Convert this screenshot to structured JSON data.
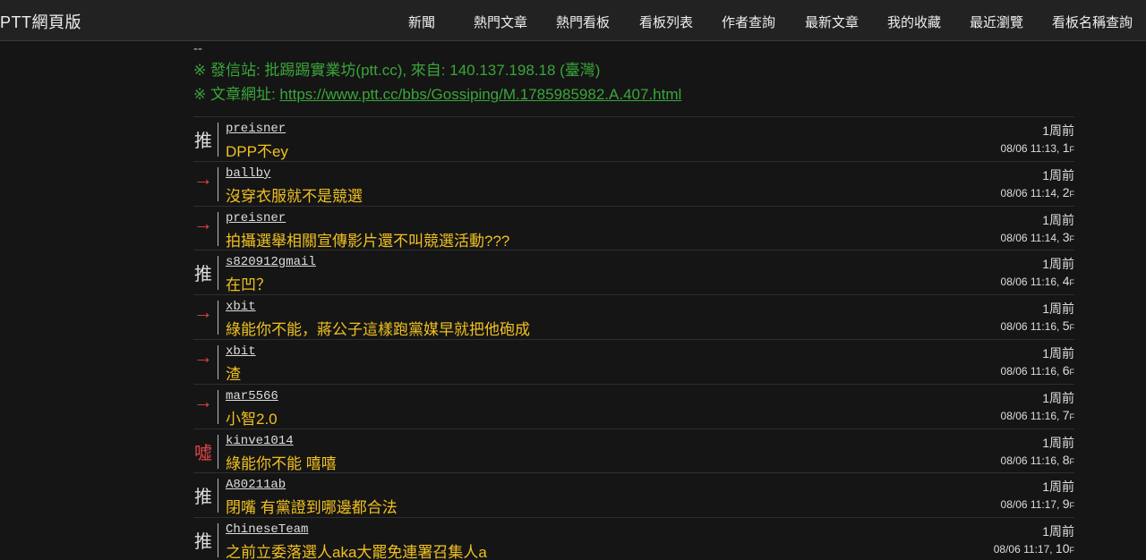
{
  "header": {
    "logo": "PTT網頁版",
    "nav": [
      {
        "label": "新聞"
      },
      {
        "label": "熱門文章"
      },
      {
        "label": "熱門看板"
      },
      {
        "label": "看板列表"
      },
      {
        "label": "作者查詢"
      },
      {
        "label": "最新文章"
      },
      {
        "label": "我的收藏"
      },
      {
        "label": "最近瀏覽"
      },
      {
        "label": "看板名稱查詢"
      }
    ]
  },
  "article": {
    "separator": "--",
    "source_line": "※ 發信站: 批踢踢實業坊(ptt.cc), 來自: 140.137.198.18 (臺灣)",
    "url_prefix": "※ 文章網址: ",
    "url": "https://www.ptt.cc/bbs/Gossiping/M.1785985982.A.407.html"
  },
  "pushes": [
    {
      "tag": "推",
      "type": "push",
      "user": "preisner",
      "msg": "DPP不ey",
      "ago": "1周前",
      "time": "08/06 11:13, ",
      "floor": "1",
      "floor_unit": "F"
    },
    {
      "tag": "→",
      "type": "arrow",
      "user": "ballby",
      "msg": "沒穿衣服就不是競選",
      "ago": "1周前",
      "time": "08/06 11:14, ",
      "floor": "2",
      "floor_unit": "F"
    },
    {
      "tag": "→",
      "type": "arrow",
      "user": "preisner",
      "msg": "拍攝選舉相關宣傳影片還不叫競選活動???",
      "ago": "1周前",
      "time": "08/06 11:14, ",
      "floor": "3",
      "floor_unit": "F"
    },
    {
      "tag": "推",
      "type": "push",
      "user": "s820912gmail",
      "msg": "在凹？",
      "ago": "1周前",
      "time": "08/06 11:16, ",
      "floor": "4",
      "floor_unit": "F"
    },
    {
      "tag": "→",
      "type": "arrow",
      "user": "xbit",
      "msg": "綠能你不能，蔣公子這樣跑黨媒早就把他砲成",
      "ago": "1周前",
      "time": "08/06 11:16, ",
      "floor": "5",
      "floor_unit": "F"
    },
    {
      "tag": "→",
      "type": "arrow",
      "user": "xbit",
      "msg": "渣",
      "ago": "1周前",
      "time": "08/06 11:16, ",
      "floor": "6",
      "floor_unit": "F"
    },
    {
      "tag": "→",
      "type": "arrow",
      "user": "mar5566",
      "msg": "小智2.0",
      "ago": "1周前",
      "time": "08/06 11:16, ",
      "floor": "7",
      "floor_unit": "F"
    },
    {
      "tag": "噓",
      "type": "boo",
      "user": "kinve1014",
      "msg": "綠能你不能 嘻嘻",
      "ago": "1周前",
      "time": "08/06 11:16, ",
      "floor": "8",
      "floor_unit": "F"
    },
    {
      "tag": "推",
      "type": "push",
      "user": "A80211ab",
      "msg": "閉嘴 有黨證到哪邊都合法",
      "ago": "1周前",
      "time": "08/06 11:17, ",
      "floor": "9",
      "floor_unit": "F"
    },
    {
      "tag": "推",
      "type": "push",
      "user": "ChineseTeam",
      "msg": "之前立委落選人aka大罷免連署召集人a",
      "ago": "1周前",
      "time": "08/06 11:17, ",
      "floor": "10",
      "floor_unit": "F"
    }
  ]
}
